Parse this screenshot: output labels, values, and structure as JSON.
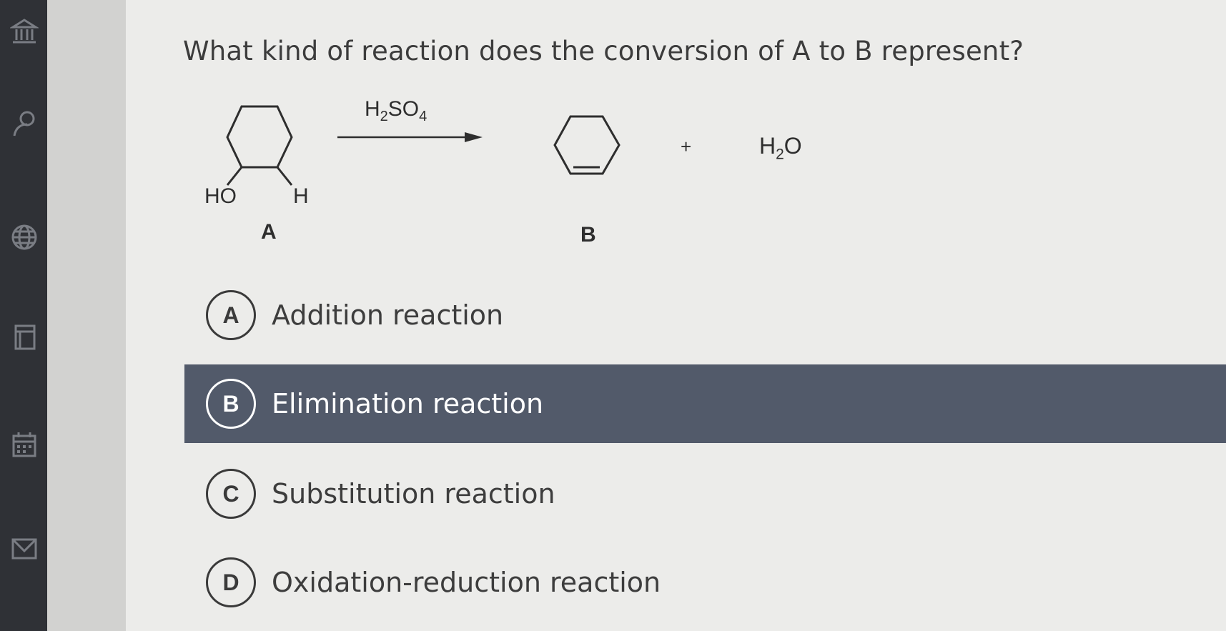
{
  "question": {
    "text": "What kind of reaction does the conversion of A to B represent?"
  },
  "scheme": {
    "reagent_main": "H",
    "reagent_sub1": "2",
    "reagent_mid": "SO",
    "reagent_sub2": "4",
    "plus": "+",
    "water_h": "H",
    "water_sub": "2",
    "water_o": "O",
    "ho_label": "HO",
    "h_label": "H",
    "label_a": "A",
    "label_b": "B"
  },
  "options": [
    {
      "letter": "A",
      "text": "Addition reaction",
      "selected": false
    },
    {
      "letter": "B",
      "text": "Elimination reaction",
      "selected": true
    },
    {
      "letter": "C",
      "text": "Substitution reaction",
      "selected": false
    },
    {
      "letter": "D",
      "text": "Oxidation-reduction reaction",
      "selected": false
    }
  ],
  "sidebar": {
    "icons": [
      "bank-icon",
      "user-icon",
      "globe-icon",
      "book-icon",
      "calendar-icon",
      "mail-icon"
    ]
  },
  "colors": {
    "selected_bg": "#525a6a",
    "sidebar_bg": "#2f3136"
  }
}
